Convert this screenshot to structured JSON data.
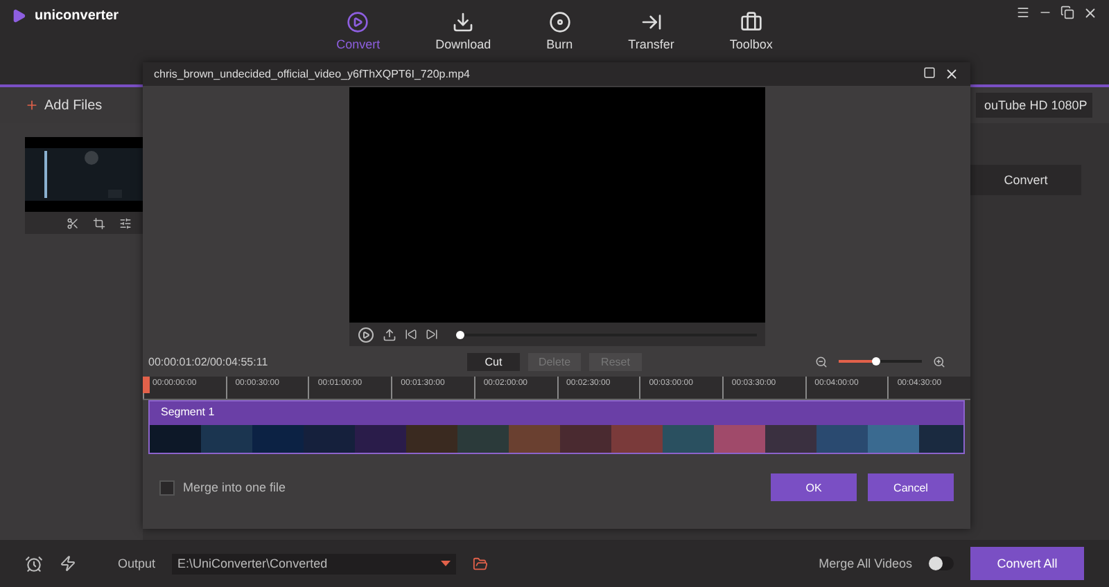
{
  "app": {
    "title": "uniconverter"
  },
  "nav": [
    {
      "label": "Convert",
      "selected": true
    },
    {
      "label": "Download",
      "selected": false
    },
    {
      "label": "Burn",
      "selected": false
    },
    {
      "label": "Transfer",
      "selected": false
    },
    {
      "label": "Toolbox",
      "selected": false
    }
  ],
  "toolbar": {
    "add_files": "Add Files",
    "format": "ouTube HD 1080P"
  },
  "file_item": {
    "convert": "Convert"
  },
  "dialog": {
    "title": "chris_brown_undecided_official_video_y6fThXQPT6I_720p.mp4",
    "progress": {
      "level": 0
    },
    "time": "00:00:01:02/00:04:55:11",
    "actions": [
      {
        "label": "Cut",
        "disabled": false
      },
      {
        "label": "Delete",
        "disabled": true
      },
      {
        "label": "Reset",
        "disabled": true
      }
    ],
    "zoom": {
      "level": 0.45
    },
    "ticks": [
      "00:00:00:00",
      "00:00:30:00",
      "00:01:00:00",
      "00:01:30:00",
      "00:02:00:00",
      "00:02:30:00",
      "00:03:00:00",
      "00:03:30:00",
      "00:04:00:00",
      "00:04:30:00"
    ],
    "segment": "Segment 1",
    "merge": {
      "label": "Merge into one file",
      "checked": false
    },
    "buttons": [
      "OK",
      "Cancel"
    ]
  },
  "bottom": {
    "output_label": "Output",
    "output_path": "E:\\UniConverter\\Converted",
    "merge_all": {
      "label": "Merge All Videos",
      "on": false
    },
    "convert_all": "Convert All"
  }
}
